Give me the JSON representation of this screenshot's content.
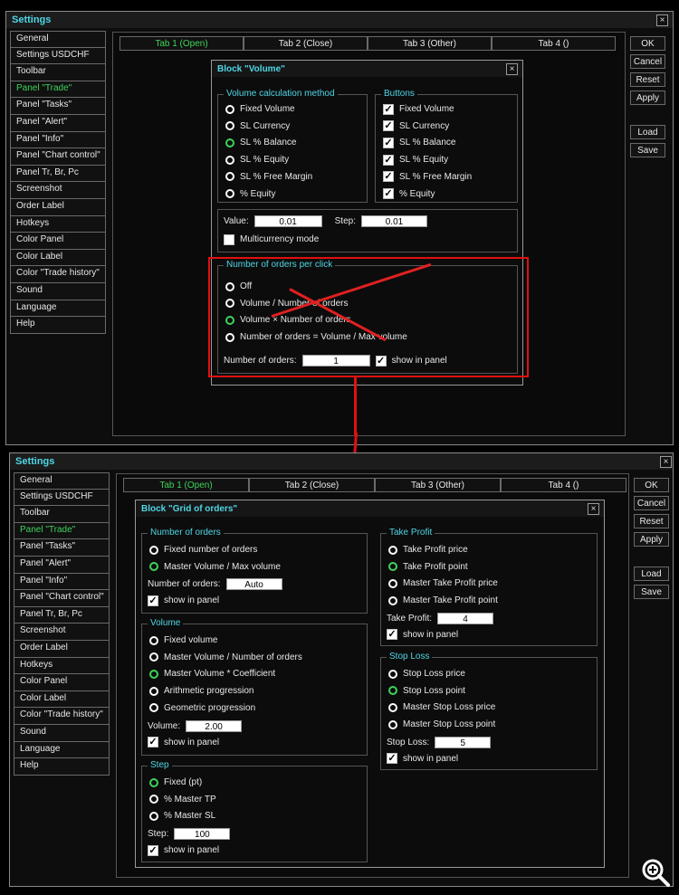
{
  "top_bar": {
    "left_text": "...",
    "right_text": "..."
  },
  "menu_items": [
    "General",
    "Settings USDCHF",
    "Toolbar",
    "Panel \"Trade\"",
    "Panel \"Tasks\"",
    "Panel \"Alert\"",
    "Panel \"Info\"",
    "Panel \"Chart control\"",
    "Panel Tr, Br, Pc",
    "Screenshot",
    "Order Label",
    "Hotkeys",
    "Color Panel",
    "Color Label",
    "Color \"Trade history\"",
    "Sound",
    "Language",
    "Help"
  ],
  "menu_active_index": 3,
  "tabs": [
    "Tab 1 (Open)",
    "Tab 2 (Close)",
    "Tab 3 (Other)",
    "Tab 4 ()"
  ],
  "side_buttons": {
    "ok": "OK",
    "cancel": "Cancel",
    "reset": "Reset",
    "apply": "Apply",
    "load": "Load",
    "save": "Save"
  },
  "close_glyph": "×",
  "colors": {
    "accent_cyan": "#4fd6e6",
    "active_green": "#3ed35a",
    "annotation_red": "#e01010"
  },
  "win1": {
    "title": "Settings",
    "block": {
      "title": "Block \"Volume\"",
      "volume_method": {
        "legend": "Volume calculation method",
        "options": [
          "Fixed Volume",
          "SL Currency",
          "SL % Balance",
          "SL % Equity",
          "SL % Free Margin",
          "% Equity"
        ],
        "selected": 2
      },
      "buttons": {
        "legend": "Buttons",
        "options": [
          "Fixed Volume",
          "SL Currency",
          "SL % Balance",
          "SL % Equity",
          "SL % Free Margin",
          "% Equity"
        ]
      },
      "value_label": "Value:",
      "value": "0.01",
      "step_label": "Step:",
      "step": "0.01",
      "multicurrency": "Multicurrency mode",
      "orders": {
        "legend": "Number of orders per click",
        "options": [
          "Off",
          "Volume / Number of orders",
          "Volume × Number of orders",
          "Number of orders = Volume / Max volume"
        ],
        "selected": 2,
        "count_label": "Number of orders:",
        "count": "1",
        "show_in_panel": "show in panel"
      }
    }
  },
  "win2": {
    "title": "Settings",
    "block": {
      "title": "Block \"Grid of orders\"",
      "num_orders": {
        "legend": "Number of orders",
        "options": [
          "Fixed number of orders",
          "Master Volume / Max volume"
        ],
        "selected": 1,
        "field_label": "Number of orders:",
        "field_value": "Auto",
        "show_in_panel": "show in panel"
      },
      "volume": {
        "legend": "Volume",
        "options": [
          "Fixed volume",
          "Master Volume / Number of orders",
          "Master Volume * Coefficient",
          "Arithmetic progression",
          "Geometric progression"
        ],
        "selected": 2,
        "field_label": "Volume:",
        "field_value": "2.00",
        "show_in_panel": "show in panel"
      },
      "step": {
        "legend": "Step",
        "options": [
          "Fixed (pt)",
          "% Master TP",
          "% Master SL"
        ],
        "selected": 0,
        "field_label": "Step:",
        "field_value": "100",
        "show_in_panel": "show in panel"
      },
      "take_profit": {
        "legend": "Take Profit",
        "options": [
          "Take Profit price",
          "Take Profit point",
          "Master Take Profit price",
          "Master Take Profit point"
        ],
        "selected": 1,
        "field_label": "Take Profit:",
        "field_value": "4",
        "show_in_panel": "show in panel"
      },
      "stop_loss": {
        "legend": "Stop Loss",
        "options": [
          "Stop Loss price",
          "Stop Loss point",
          "Master Stop Loss price",
          "Master Stop Loss point"
        ],
        "selected": 1,
        "field_label": "Stop Loss:",
        "field_value": "5",
        "show_in_panel": "show in panel"
      }
    }
  }
}
